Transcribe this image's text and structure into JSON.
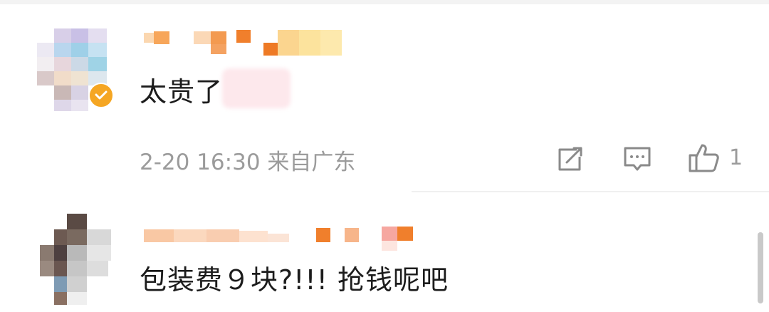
{
  "comments": [
    {
      "text": "太贵了",
      "timestamp": "2-20 16:30",
      "location": "来自广东",
      "like_count": "1",
      "verified": true
    },
    {
      "text": "包装费９块?!!! 抢钱呢吧"
    }
  ],
  "icons": {
    "share": "share-icon",
    "reply": "comment-icon",
    "like": "thumbs-up-icon",
    "verified": "verified-badge-icon"
  },
  "colors": {
    "text": "#1c1c1c",
    "meta": "#9b9b9b",
    "verified_badge": "#f5a623",
    "divider": "#f0f0f0"
  }
}
